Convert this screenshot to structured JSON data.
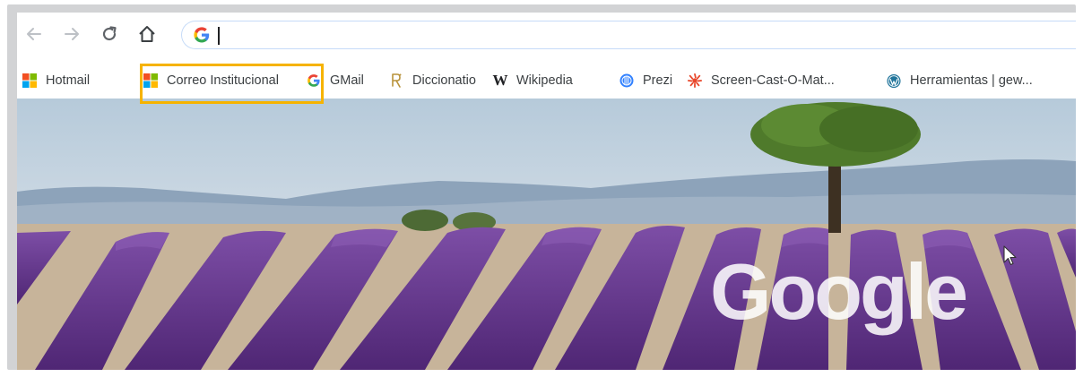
{
  "browser": {
    "omnibox": {
      "value": "",
      "placeholder": ""
    },
    "nav_icons": [
      "back-arrow-icon",
      "forward-arrow-icon",
      "reload-icon",
      "home-icon"
    ]
  },
  "bookmarks": [
    {
      "label": "Hotmail",
      "icon": "microsoft-logo-icon"
    },
    {
      "label": "Correo Institucional",
      "icon": "microsoft-logo-icon",
      "highlighted": true
    },
    {
      "label": "GMail",
      "icon": "google-g-icon"
    },
    {
      "label": "Diccionatio",
      "icon": "rae-icon"
    },
    {
      "label": "Wikipedia",
      "icon": "wikipedia-w-icon"
    },
    {
      "label": "Prezi",
      "icon": "prezi-icon"
    },
    {
      "label": "Screen-Cast-O-Mat...",
      "icon": "screencastomatic-icon"
    },
    {
      "label": "Herramientas | gew...",
      "icon": "wordpress-icon"
    }
  ],
  "hero": {
    "logo_text": "Google"
  },
  "colors": {
    "highlight": "#f6b300",
    "lavender": "#6b3a8f",
    "sky": "#c9d7e3"
  }
}
